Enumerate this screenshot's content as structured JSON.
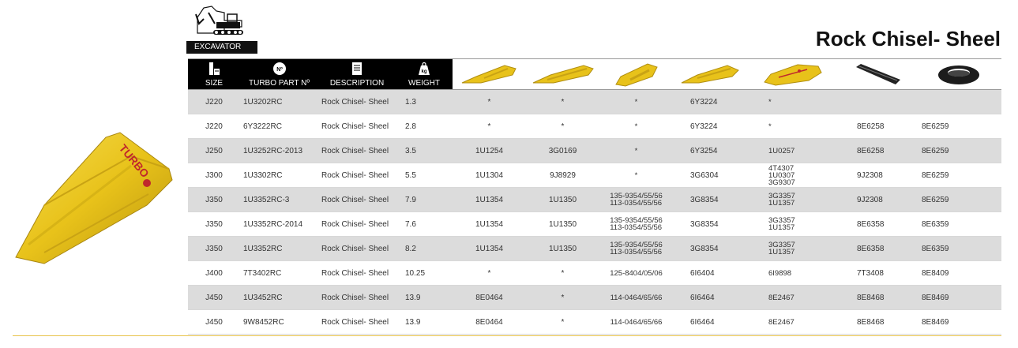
{
  "header": {
    "category_label": "EXCAVATOR",
    "title": "Rock Chisel- Sheel"
  },
  "table": {
    "headers": {
      "size": "SIZE",
      "part": "TURBO PART Nº",
      "description": "DESCRIPTION",
      "weight": "WEIGHT",
      "weight_badge": "kg",
      "part_badge": "Nº"
    },
    "picture_columns": [
      "tooth-1-icon",
      "tooth-2-icon",
      "tooth-3-icon",
      "tooth-4-icon",
      "tooth-5-icon",
      "pin-icon",
      "retainer-icon"
    ],
    "rows": [
      {
        "size": "J220",
        "part": "1U3202RC",
        "desc": "Rock Chisel- Sheel",
        "weight": "1.3",
        "c1": "*",
        "c2": "*",
        "c3": [
          "*"
        ],
        "c4": "6Y3224",
        "c5": [
          "*"
        ],
        "c6": "",
        "c7": ""
      },
      {
        "size": "J220",
        "part": "6Y3222RC",
        "desc": "Rock Chisel- Sheel",
        "weight": "2.8",
        "c1": "*",
        "c2": "*",
        "c3": [
          "*"
        ],
        "c4": "6Y3224",
        "c5": [
          "*"
        ],
        "c6": "8E6258",
        "c7": "8E6259"
      },
      {
        "size": "J250",
        "part": "1U3252RC-2013",
        "desc": "Rock Chisel- Sheel",
        "weight": "3.5",
        "c1": "1U1254",
        "c2": "3G0169",
        "c3": [
          "*"
        ],
        "c4": "6Y3254",
        "c5": [
          "1U0257"
        ],
        "c6": "8E6258",
        "c7": "8E6259"
      },
      {
        "size": "J300",
        "part": "1U3302RC",
        "desc": "Rock Chisel- Sheel",
        "weight": "5.5",
        "c1": "1U1304",
        "c2": "9J8929",
        "c3": [
          "*"
        ],
        "c4": "3G6304",
        "c5": [
          "4T4307",
          "1U0307",
          "3G9307"
        ],
        "c6": "9J2308",
        "c7": "8E6259"
      },
      {
        "size": "J350",
        "part": "1U3352RC-3",
        "desc": "Rock Chisel- Sheel",
        "weight": "7.9",
        "c1": "1U1354",
        "c2": "1U1350",
        "c3": [
          "135-9354/55/56",
          "113-0354/55/56"
        ],
        "c4": "3G8354",
        "c5": [
          "3G3357",
          "1U1357"
        ],
        "c6": "9J2308",
        "c7": "8E6259"
      },
      {
        "size": "J350",
        "part": "1U3352RC-2014",
        "desc": "Rock Chisel- Sheel",
        "weight": "7.6",
        "c1": "1U1354",
        "c2": "1U1350",
        "c3": [
          "135-9354/55/56",
          "113-0354/55/56"
        ],
        "c4": "3G8354",
        "c5": [
          "3G3357",
          "1U1357"
        ],
        "c6": "8E6358",
        "c7": "8E6359"
      },
      {
        "size": "J350",
        "part": "1U3352RC",
        "desc": "Rock Chisel- Sheel",
        "weight": "8.2",
        "c1": "1U1354",
        "c2": "1U1350",
        "c3": [
          "135-9354/55/56",
          "113-0354/55/56"
        ],
        "c4": "3G8354",
        "c5": [
          "3G3357",
          "1U1357"
        ],
        "c6": "8E6358",
        "c7": "8E6359"
      },
      {
        "size": "J400",
        "part": "7T3402RC",
        "desc": "Rock Chisel- Sheel",
        "weight": "10.25",
        "c1": "*",
        "c2": "*",
        "c3": [
          "125-8404/05/06"
        ],
        "c4": "6I6404",
        "c5": [
          "6I9898"
        ],
        "c6": "7T3408",
        "c7": "8E8409"
      },
      {
        "size": "J450",
        "part": "1U3452RC",
        "desc": "Rock Chisel- Sheel",
        "weight": "13.9",
        "c1": "8E0464",
        "c2": "*",
        "c3": [
          "114-0464/65/66"
        ],
        "c4": "6I6464",
        "c5": [
          "8E2467"
        ],
        "c6": "8E8468",
        "c7": "8E8469"
      },
      {
        "size": "J450",
        "part": "9W8452RC",
        "desc": "Rock Chisel- Sheel",
        "weight": "13.9",
        "c1": "8E0464",
        "c2": "*",
        "c3": [
          "114-0464/65/66"
        ],
        "c4": "6I6464",
        "c5": [
          "8E2467"
        ],
        "c6": "8E8468",
        "c7": "8E8469"
      }
    ]
  },
  "product_image": {
    "logo_text": "TURBO",
    "color": "#e8c21a"
  },
  "colors": {
    "header_bg": "#000000",
    "row_shade": "#dcdcdc",
    "accent_yellow": "#e8c21a",
    "rule": "#e7c34a"
  }
}
